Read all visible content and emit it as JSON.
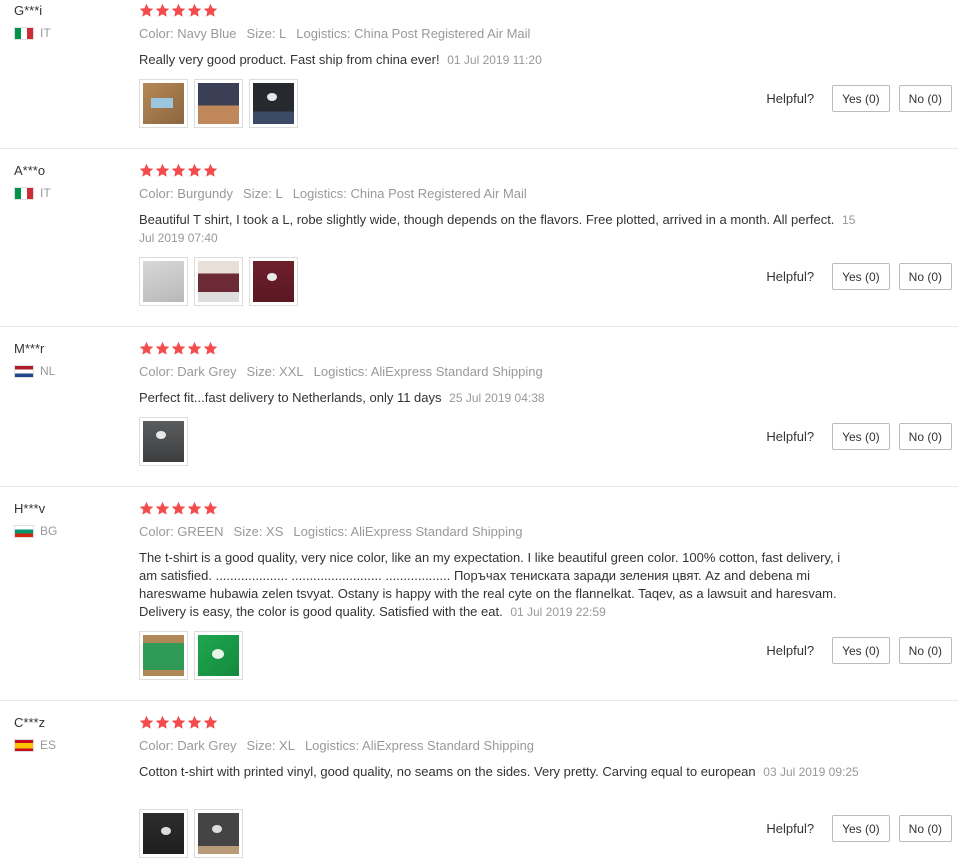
{
  "reviews": [
    {
      "user": "G***i",
      "country": "IT",
      "rating": 5,
      "color": "Color: Navy Blue",
      "size": "Size: L",
      "logistics": "Logistics: China Post Registered Air Mail",
      "text": "Really very good product. Fast ship from china ever!",
      "date": "01 Jul 2019 11:20",
      "photos": 3,
      "helpful_label": "Helpful?",
      "yes_label": "Yes (0)",
      "no_label": "No (0)"
    },
    {
      "user": "A***o",
      "country": "IT",
      "rating": 5,
      "color": "Color: Burgundy",
      "size": "Size: L",
      "logistics": "Logistics: China Post Registered Air Mail",
      "text": "Beautiful T shirt, I took a L, robe slightly wide, though depends on the flavors. Free plotted, arrived in a month. All perfect.",
      "date": "15 Jul 2019 07:40",
      "photos": 3,
      "helpful_label": "Helpful?",
      "yes_label": "Yes (0)",
      "no_label": "No (0)"
    },
    {
      "user": "M***r",
      "country": "NL",
      "rating": 5,
      "color": "Color: Dark Grey",
      "size": "Size: XXL",
      "logistics": "Logistics: AliExpress Standard Shipping",
      "text": "Perfect fit...fast delivery to Netherlands, only 11 days",
      "date": "25 Jul 2019 04:38",
      "photos": 1,
      "helpful_label": "Helpful?",
      "yes_label": "Yes (0)",
      "no_label": "No (0)"
    },
    {
      "user": "H***v",
      "country": "BG",
      "rating": 5,
      "color": "Color: GREEN",
      "size": "Size: XS",
      "logistics": "Logistics: AliExpress Standard Shipping",
      "text": "The t-shirt is a good quality, very nice color, like an my expectation. I like beautiful green color. 100% cotton, fast delivery, i am satisfied. .................... ......................... .................. Поръчах тениската заради зеления цвят. Az and debena mi hareswame hubawia zelen tsvyat. Ostany is happy with the real cyte on the flannelkat. Taqev, as a lawsuit and haresvam. Delivery is easy, the color is good quality. Satisfied with the eat.",
      "date": "01 Jul 2019 22:59",
      "photos": 2,
      "helpful_label": "Helpful?",
      "yes_label": "Yes (0)",
      "no_label": "No (0)"
    },
    {
      "user": "C***z",
      "country": "ES",
      "rating": 5,
      "color": "Color: Dark Grey",
      "size": "Size: XL",
      "logistics": "Logistics: AliExpress Standard Shipping",
      "text": "Cotton t-shirt with printed vinyl, good quality, no seams on the sides. Very pretty. Carving equal to european",
      "date": "03 Jul 2019 09:25",
      "photos": 2,
      "helpful_label": "Helpful?",
      "yes_label": "Yes (0)",
      "no_label": "No (0)"
    }
  ],
  "colors": {
    "star": "#f44b4b",
    "meta": "#999999",
    "text": "#333333"
  }
}
